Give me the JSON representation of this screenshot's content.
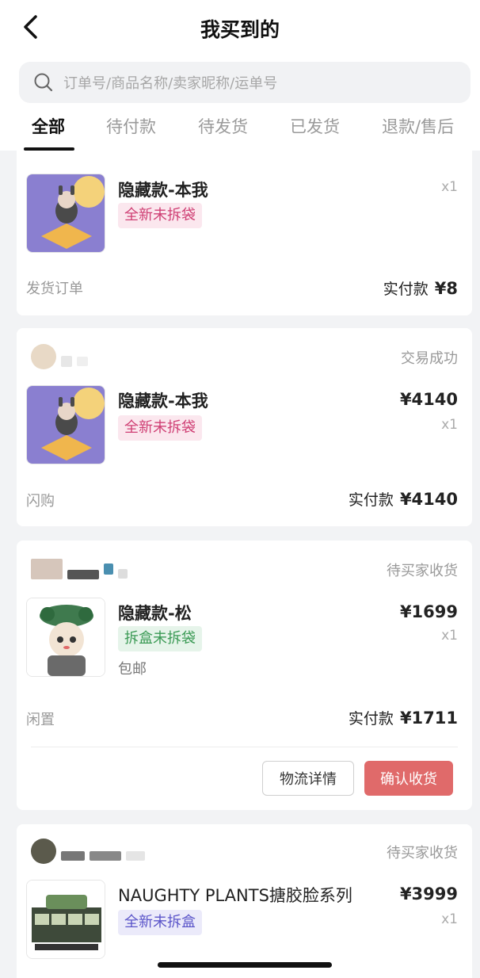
{
  "header": {
    "title": "我买到的",
    "back_icon": "chevron-left-icon",
    "search_placeholder": "订单号/商品名称/卖家昵称/运单号"
  },
  "tabs": [
    {
      "label": "全部",
      "active": true
    },
    {
      "label": "待付款"
    },
    {
      "label": "待发货"
    },
    {
      "label": "已发货"
    },
    {
      "label": "退款/售后"
    }
  ],
  "orders": [
    {
      "product": "隐藏款-本我",
      "tag": "全新未拆袋",
      "quantity": "x1",
      "source": "发货订单",
      "paid_label": "实付款",
      "paid_amount": "¥8"
    },
    {
      "status": "交易成功",
      "product": "隐藏款-本我",
      "tag": "全新未拆袋",
      "price": "¥4140",
      "quantity": "x1",
      "source": "闪购",
      "paid_label": "实付款",
      "paid_amount": "¥4140"
    },
    {
      "status": "待买家收货",
      "product": "隐藏款-松",
      "tag": "拆盒未拆袋",
      "shipping": "包邮",
      "price": "¥1699",
      "quantity": "x1",
      "source": "闲置",
      "paid_label": "实付款",
      "paid_amount": "¥1711",
      "btn_logistics": "物流详情",
      "btn_confirm": "确认收货"
    },
    {
      "status": "待买家收货",
      "product": "NAUGHTY PLANTS搪胶脸系列",
      "tag": "全新未拆盒",
      "price": "¥3999",
      "quantity": "x1"
    }
  ],
  "colors": {
    "accent_red": "#e06a6a",
    "tag_pink": "#cf3f74",
    "tag_green": "#3b9a55",
    "tag_blue": "#5b55c9"
  }
}
